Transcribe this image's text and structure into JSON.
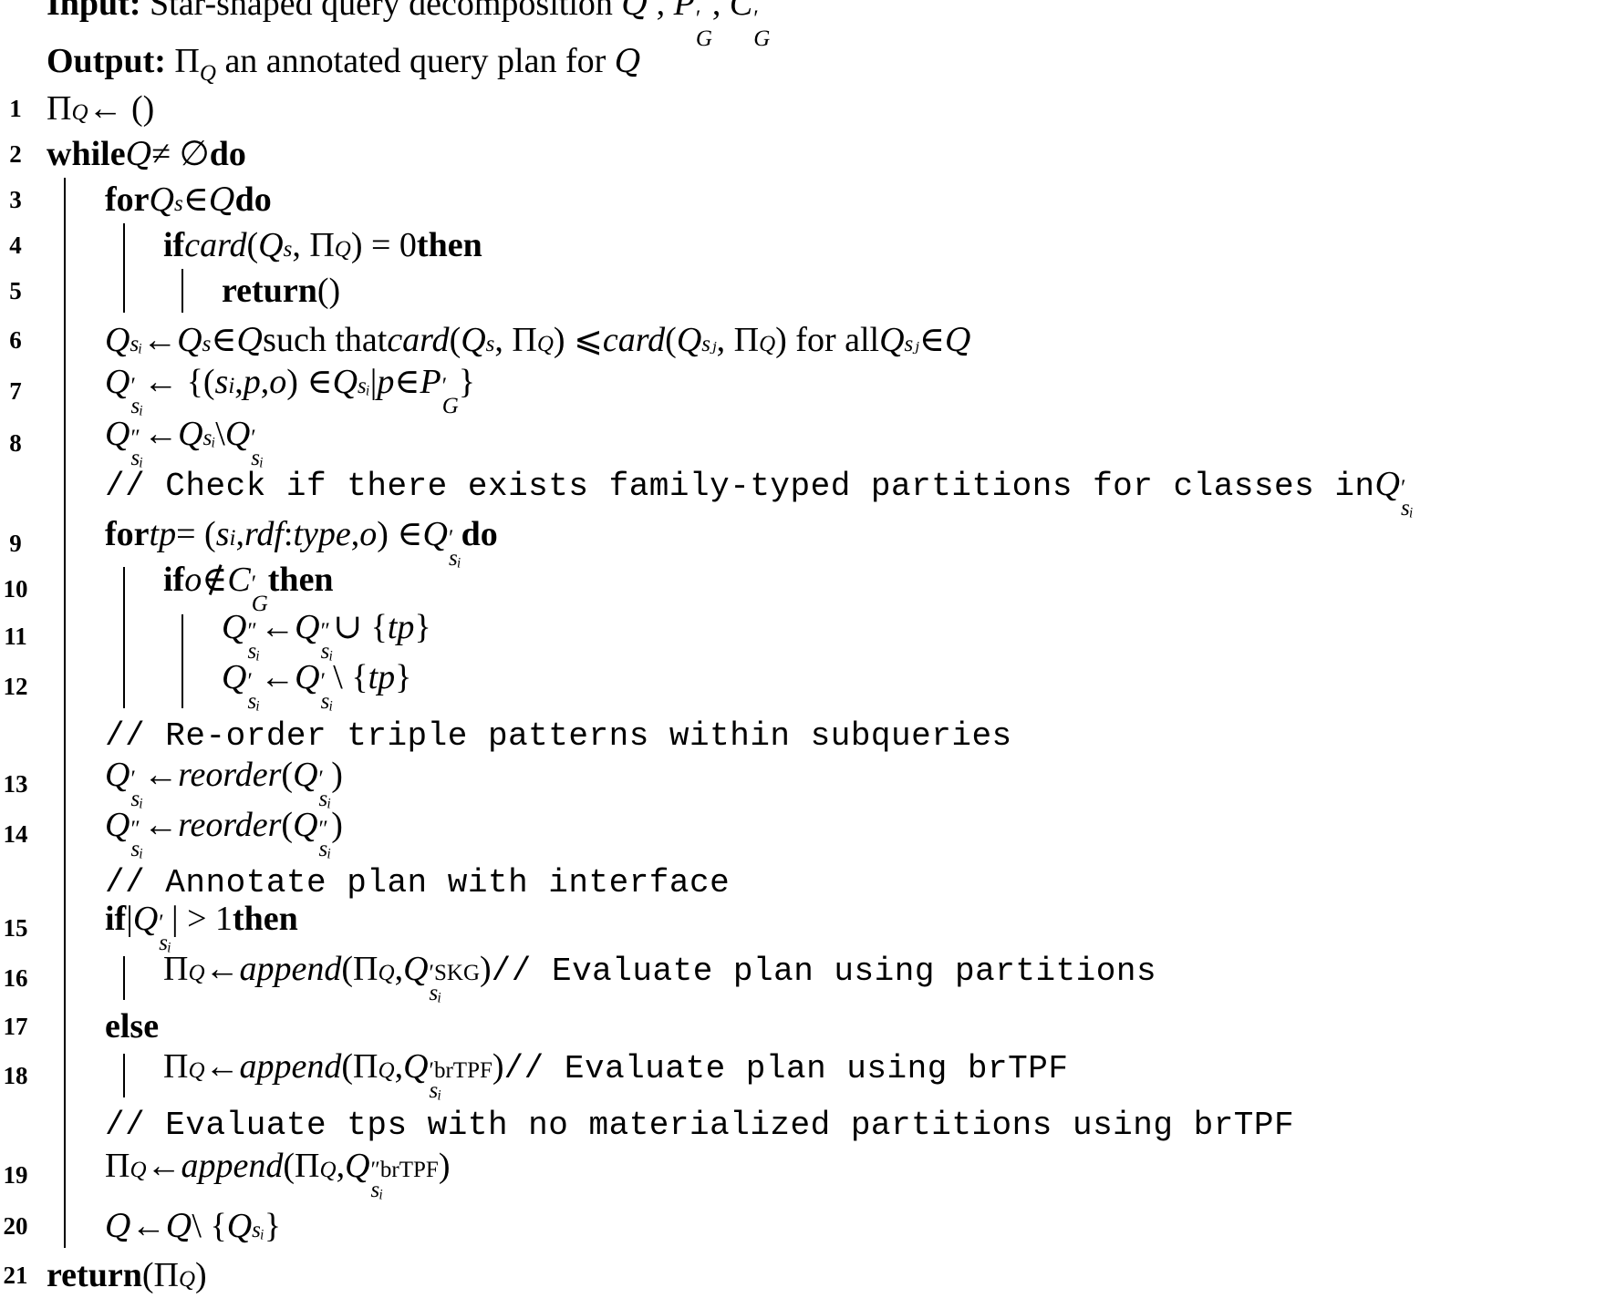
{
  "algorithm": {
    "input": {
      "label": "Input:",
      "segments": [
        {
          "t": "Star-shaped query decomposition "
        },
        {
          "t": "Q",
          "c": "cal"
        },
        {
          "t": " , "
        },
        {
          "t": "P",
          "c": "it"
        },
        {
          "sup": "′",
          "sub": "G"
        },
        {
          "t": ", "
        },
        {
          "t": "C",
          "c": "it"
        },
        {
          "sup": "′",
          "sub": "G"
        }
      ]
    },
    "output": {
      "label": "Output:",
      "segments": [
        {
          "t": "Π"
        },
        {
          "sub": "Q"
        },
        {
          "t": " an annotated query plan for "
        },
        {
          "t": "Q",
          "c": "cal"
        }
      ]
    },
    "lines": [
      {
        "num": "1",
        "indent": 0,
        "segments": [
          {
            "t": "Π"
          },
          {
            "sub": "Q"
          },
          {
            "t": " ← ()"
          }
        ]
      },
      {
        "num": "2",
        "indent": 0,
        "segments": [
          {
            "t": "while ",
            "c": "kw"
          },
          {
            "t": "Q",
            "c": "cal"
          },
          {
            "t": " ≠ ∅ "
          },
          {
            "t": "do",
            "c": "kw"
          }
        ]
      },
      {
        "num": "3",
        "indent": 1,
        "segments": [
          {
            "t": "for ",
            "c": "kw"
          },
          {
            "t": "Q",
            "c": "it"
          },
          {
            "sub": "s"
          },
          {
            "t": " ∈ "
          },
          {
            "t": "Q",
            "c": "cal"
          },
          {
            "t": " do",
            "c": "kw"
          }
        ]
      },
      {
        "num": "4",
        "indent": 2,
        "segments": [
          {
            "t": "if ",
            "c": "kw"
          },
          {
            "t": "card",
            "c": "it"
          },
          {
            "t": "("
          },
          {
            "t": "Q",
            "c": "it"
          },
          {
            "sub": "s"
          },
          {
            "t": ", Π"
          },
          {
            "sub": "Q"
          },
          {
            "t": ") = 0 "
          },
          {
            "t": "then",
            "c": "kw"
          }
        ]
      },
      {
        "num": "5",
        "indent": 3,
        "segments": [
          {
            "t": "return ",
            "c": "kw"
          },
          {
            "t": "()"
          }
        ]
      },
      {
        "num": "6",
        "indent": 1,
        "segments": [
          {
            "t": "Q",
            "c": "it"
          },
          {
            "sub": "sᵢ"
          },
          {
            "t": " ← "
          },
          {
            "t": "Q",
            "c": "it"
          },
          {
            "sub": "s"
          },
          {
            "t": " ∈ "
          },
          {
            "t": "Q",
            "c": "cal"
          },
          {
            "t": " such that "
          },
          {
            "t": "card",
            "c": "it"
          },
          {
            "t": "("
          },
          {
            "t": "Q",
            "c": "it"
          },
          {
            "sub": "s"
          },
          {
            "t": ", Π"
          },
          {
            "sub": "Q"
          },
          {
            "t": ") ⩽ "
          },
          {
            "t": "card",
            "c": "it"
          },
          {
            "t": "("
          },
          {
            "t": "Q",
            "c": "it"
          },
          {
            "sub": "sⱼ"
          },
          {
            "t": ", Π"
          },
          {
            "sub": "Q"
          },
          {
            "t": ") for all "
          },
          {
            "t": "Q",
            "c": "it"
          },
          {
            "sub": "sⱼ"
          },
          {
            "t": " ∈ "
          },
          {
            "t": "Q",
            "c": "cal"
          }
        ]
      },
      {
        "num": "7",
        "indent": 1,
        "segments": [
          {
            "t": "Q",
            "c": "it"
          },
          {
            "sup": "′",
            "sub": "sᵢ"
          },
          {
            "t": " ← {("
          },
          {
            "t": "s",
            "c": "it"
          },
          {
            "sub": "i"
          },
          {
            "t": ", "
          },
          {
            "t": "p",
            "c": "it"
          },
          {
            "t": ", "
          },
          {
            "t": "o",
            "c": "it"
          },
          {
            "t": ") ∈ "
          },
          {
            "t": "Q",
            "c": "it"
          },
          {
            "sub": "sᵢ"
          },
          {
            "t": " |"
          },
          {
            "t": "p",
            "c": "it"
          },
          {
            "t": " ∈ "
          },
          {
            "t": "P",
            "c": "it"
          },
          {
            "sup": "′",
            "sub": "G"
          },
          {
            "t": "}"
          }
        ]
      },
      {
        "num": "8",
        "indent": 1,
        "segments": [
          {
            "t": "Q",
            "c": "it"
          },
          {
            "sup": "″",
            "sub": "sᵢ"
          },
          {
            "t": " ← "
          },
          {
            "t": "Q",
            "c": "it"
          },
          {
            "sub": "sᵢ"
          },
          {
            "t": " \\ "
          },
          {
            "t": "Q",
            "c": "it"
          },
          {
            "sup": "′",
            "sub": "sᵢ"
          }
        ]
      },
      {
        "num": "",
        "indent": 1,
        "segments": [
          {
            "t": "// Check if there exists family-typed partitions for classes in ",
            "c": "mono"
          },
          {
            "t": "Q",
            "c": "it"
          },
          {
            "sup": "′",
            "sub": "sᵢ"
          }
        ]
      },
      {
        "num": "9",
        "indent": 1,
        "segments": [
          {
            "t": "for ",
            "c": "kw"
          },
          {
            "t": "tp",
            "c": "it"
          },
          {
            "t": " = ("
          },
          {
            "t": "s",
            "c": "it"
          },
          {
            "sub": "i"
          },
          {
            "t": ", "
          },
          {
            "t": "rdf",
            "c": "it"
          },
          {
            "t": " : "
          },
          {
            "t": "type",
            "c": "it"
          },
          {
            "t": ", "
          },
          {
            "t": "o",
            "c": "it"
          },
          {
            "t": ") ∈ "
          },
          {
            "t": "Q",
            "c": "it"
          },
          {
            "sup": "′",
            "sub": "sᵢ"
          },
          {
            "t": " do",
            "c": "kw"
          }
        ]
      },
      {
        "num": "10",
        "indent": 2,
        "segments": [
          {
            "t": "if ",
            "c": "kw"
          },
          {
            "t": "o",
            "c": "it"
          },
          {
            "t": " ∉ "
          },
          {
            "t": "C",
            "c": "it"
          },
          {
            "sup": "′",
            "sub": "G"
          },
          {
            "t": " then",
            "c": "kw"
          }
        ]
      },
      {
        "num": "11",
        "indent": 3,
        "segments": [
          {
            "t": "Q",
            "c": "it"
          },
          {
            "sup": "″",
            "sub": "sᵢ"
          },
          {
            "t": " ← "
          },
          {
            "t": "Q",
            "c": "it"
          },
          {
            "sup": "″",
            "sub": "sᵢ"
          },
          {
            "t": " ∪ {"
          },
          {
            "t": "tp",
            "c": "it"
          },
          {
            "t": "}"
          }
        ]
      },
      {
        "num": "12",
        "indent": 3,
        "segments": [
          {
            "t": "Q",
            "c": "it"
          },
          {
            "sup": "′",
            "sub": "sᵢ"
          },
          {
            "t": " ← "
          },
          {
            "t": "Q",
            "c": "it"
          },
          {
            "sup": "′",
            "sub": "sᵢ"
          },
          {
            "t": " \\ {"
          },
          {
            "t": "tp",
            "c": "it"
          },
          {
            "t": "}"
          }
        ]
      },
      {
        "num": "",
        "indent": 1,
        "segments": [
          {
            "t": "// Re-order triple patterns within subqueries",
            "c": "mono"
          }
        ]
      },
      {
        "num": "13",
        "indent": 1,
        "segments": [
          {
            "t": "Q",
            "c": "it"
          },
          {
            "sup": "′",
            "sub": "sᵢ"
          },
          {
            "t": " ← "
          },
          {
            "t": "reorder",
            "c": "it"
          },
          {
            "t": "("
          },
          {
            "t": "Q",
            "c": "it"
          },
          {
            "sup": "′",
            "sub": "sᵢ"
          },
          {
            "t": ")"
          }
        ]
      },
      {
        "num": "14",
        "indent": 1,
        "segments": [
          {
            "t": "Q",
            "c": "it"
          },
          {
            "sup": "″",
            "sub": "sᵢ"
          },
          {
            "t": " ← "
          },
          {
            "t": "reorder",
            "c": "it"
          },
          {
            "t": "("
          },
          {
            "t": "Q",
            "c": "it"
          },
          {
            "sup": "″",
            "sub": "sᵢ"
          },
          {
            "t": ")"
          }
        ]
      },
      {
        "num": "",
        "indent": 1,
        "segments": [
          {
            "t": "// Annotate plan with interface",
            "c": "mono"
          }
        ]
      },
      {
        "num": "15",
        "indent": 1,
        "segments": [
          {
            "t": "if ",
            "c": "kw"
          },
          {
            "t": "|"
          },
          {
            "t": "Q",
            "c": "it"
          },
          {
            "sup": "′",
            "sub": "sᵢ"
          },
          {
            "t": "| > 1 "
          },
          {
            "t": "then",
            "c": "kw"
          }
        ]
      },
      {
        "num": "16",
        "indent": 2,
        "segments": [
          {
            "t": "Π"
          },
          {
            "sub": "Q"
          },
          {
            "t": " ← "
          },
          {
            "t": "append",
            "c": "it"
          },
          {
            "t": "(Π"
          },
          {
            "sub": "Q"
          },
          {
            "t": ", "
          },
          {
            "t": "Q",
            "c": "it"
          },
          {
            "sup": "′SKG",
            "sub": "sᵢ"
          },
          {
            "t": ") "
          },
          {
            "t": "// Evaluate plan using partitions",
            "c": "mono"
          }
        ]
      },
      {
        "num": "17",
        "indent": 1,
        "segments": [
          {
            "t": "else",
            "c": "kw"
          }
        ]
      },
      {
        "num": "18",
        "indent": 2,
        "segments": [
          {
            "t": "Π"
          },
          {
            "sub": "Q"
          },
          {
            "t": " ← "
          },
          {
            "t": "append",
            "c": "it"
          },
          {
            "t": "(Π"
          },
          {
            "sub": "Q"
          },
          {
            "t": ", "
          },
          {
            "t": "Q",
            "c": "it"
          },
          {
            "sup": "′brTPF",
            "sub": "sᵢ"
          },
          {
            "t": ") "
          },
          {
            "t": "// Evaluate plan using brTPF",
            "c": "mono"
          }
        ]
      },
      {
        "num": "",
        "indent": 1,
        "segments": [
          {
            "t": "// Evaluate tps with no materialized partitions using brTPF",
            "c": "mono"
          }
        ]
      },
      {
        "num": "19",
        "indent": 1,
        "segments": [
          {
            "t": "Π"
          },
          {
            "sub": "Q"
          },
          {
            "t": " ← "
          },
          {
            "t": "append",
            "c": "it"
          },
          {
            "t": "(Π"
          },
          {
            "sub": "Q"
          },
          {
            "t": ", "
          },
          {
            "t": "Q",
            "c": "it"
          },
          {
            "sup": "″brTPF",
            "sub": "sᵢ"
          },
          {
            "t": ")"
          }
        ]
      },
      {
        "num": "20",
        "indent": 1,
        "segments": [
          {
            "t": "Q",
            "c": "cal"
          },
          {
            "t": " ← "
          },
          {
            "t": "Q",
            "c": "cal"
          },
          {
            "t": " \\ {"
          },
          {
            "t": "Q",
            "c": "it"
          },
          {
            "sub": "sᵢ"
          },
          {
            "t": "}"
          }
        ]
      },
      {
        "num": "21",
        "indent": 0,
        "segments": [
          {
            "t": "return ",
            "c": "kw"
          },
          {
            "t": "(Π"
          },
          {
            "sub": "Q"
          },
          {
            "t": ")"
          }
        ]
      }
    ]
  }
}
